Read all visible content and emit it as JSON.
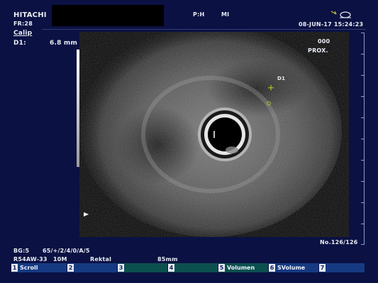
{
  "header": {
    "brand": "HITACHI",
    "frame_rate": "FR:28",
    "power_indicator": "P:H",
    "mechanical_index": "MI",
    "date_time": "08-JUN-17  15:24:23"
  },
  "measurement": {
    "mode": "Calip",
    "d1_label": "D1:",
    "d1_value": "6.8 mm",
    "d1_marker": "D1"
  },
  "orientation": {
    "code": "000",
    "position": "PROX."
  },
  "footer": {
    "bg": "BG:5",
    "bg_params": "65/+/2/4/0/A/5",
    "probe": "R54AW-33",
    "frequency": "10M",
    "application": "Rektal",
    "depth": "85mm",
    "frame_counter": "No.126/126"
  },
  "softkeys": [
    {
      "num": "1",
      "label": "Scroll",
      "color": "blue"
    },
    {
      "num": "2",
      "label": "",
      "color": "blue"
    },
    {
      "num": "3",
      "label": "",
      "color": "teal"
    },
    {
      "num": "4",
      "label": "",
      "color": "teal"
    },
    {
      "num": "5",
      "label": "Volumen",
      "color": "teal"
    },
    {
      "num": "6",
      "label": "SVolume",
      "color": "blue"
    },
    {
      "num": "7",
      "label": "",
      "color": "blue"
    }
  ],
  "colors": {
    "background": "#0b1142",
    "softkey_teal": "#0c5050",
    "softkey_blue": "#163a82",
    "caliper_marker": "#c8d020"
  },
  "icons": [
    "probe-icon",
    "gray-scale-bar",
    "depth-scale",
    "focus-marker-icon",
    "caliper-cross-icon"
  ]
}
